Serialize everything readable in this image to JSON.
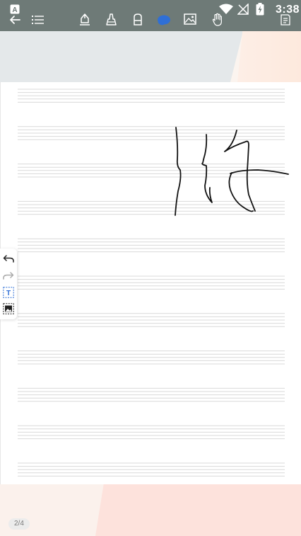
{
  "status_bar": {
    "time": "3:38"
  },
  "toolbar": {
    "icons": [
      "back-arrow-icon",
      "outline-list-icon",
      "pen-icon",
      "highlighter-icon",
      "eraser-icon",
      "shape-lasso-icon",
      "image-icon",
      "hand-pan-icon",
      "page-settings-icon"
    ],
    "active_tool": "shape-lasso-icon",
    "accent_color": "#2f6fd6"
  },
  "side_tools": {
    "icons": [
      "undo-icon",
      "redo-icon",
      "text-box-icon",
      "insert-image-icon"
    ]
  },
  "page": {
    "indicator": "2/4"
  },
  "colors": {
    "toolbar_bg": "#6e7a77",
    "ink": "#111111",
    "staff_line": "#d9d9d9"
  }
}
